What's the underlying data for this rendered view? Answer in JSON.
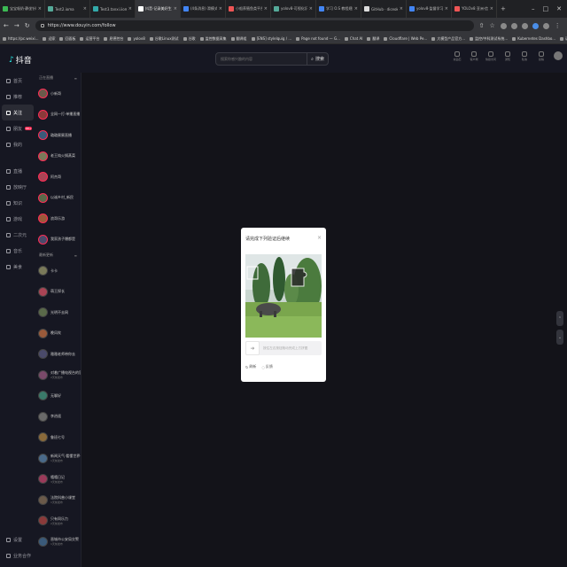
{
  "browser": {
    "tabs": [
      {
        "title": "宝宝吸奶·静坐针吹聊",
        "color": "#3cba54",
        "active": false
      },
      {
        "title": "Test2.ioma",
        "color": "#5a9",
        "active": false
      },
      {
        "title": "Test3.tanxi.iioma",
        "color": "#3aa",
        "active": false
      },
      {
        "title": "抖音-记录美好生活",
        "color": "#fff",
        "active": true
      },
      {
        "title": "(4条消息) 滑模式辅助定",
        "color": "#4285f4",
        "active": false
      },
      {
        "title": "小船养殖鱼类平台",
        "color": "#e55",
        "active": false
      },
      {
        "title": "yolov8-可视化识图工具",
        "color": "#5a9",
        "active": false
      },
      {
        "title": "学习 O.S 教程规则文",
        "color": "#4285f4",
        "active": false
      },
      {
        "title": "GitHub · diceoks/lehris",
        "color": "#ddd",
        "active": false
      },
      {
        "title": "yolov8·监督学习教程",
        "color": "#4285f4",
        "active": false
      },
      {
        "title": "YOLOv8 亚洲·信仰",
        "color": "#e55",
        "active": false
      }
    ],
    "new_tab_label": "+",
    "url": "https://www.douyin.com/follow",
    "bookmarks": [
      "https://pc.weixi...",
      "迎家",
      "回面板",
      "运营平台",
      "屈德控台",
      "yolov8",
      "谷歌Linux测试",
      "谷歌",
      "监控数据采集",
      "翻译组",
      "[ENS] stylelquig / ...",
      "Page not found — G...",
      "Chat AI",
      "翻译",
      "Cloudflare | Web Pe...",
      "大模型产品官方...",
      "监控/中科测试系统...",
      "Kubernetes Dashbo...",
      "语音服务平台",
      "语音文档",
      "微信",
      "语音控制",
      "所有书签"
    ]
  },
  "site": {
    "logo": "抖音",
    "search_placeholder": "搜索你感兴趣的内容",
    "search_button": "搜索",
    "top_icons": [
      "充钻石",
      "客户端",
      "快捷访问",
      "通知",
      "私信",
      "投稿",
      ""
    ]
  },
  "leftnav": {
    "items": [
      {
        "label": "首页",
        "active": false,
        "badge": ""
      },
      {
        "label": "推荐",
        "active": false,
        "badge": ""
      },
      {
        "label": "关注",
        "active": true,
        "badge": ""
      },
      {
        "label": "朋友",
        "active": false,
        "badge": "99+"
      },
      {
        "label": "我的",
        "active": false,
        "badge": ""
      }
    ],
    "items2": [
      "直播",
      "放映厅",
      "知识",
      "游戏",
      "二次元",
      "音乐",
      "美食"
    ],
    "bottom": [
      "设置",
      "业务合作"
    ]
  },
  "follow": {
    "header": "正在直播",
    "header2": "最新更新",
    "live": [
      "小新哥",
      "全网一打·单播直播",
      "璐璐蜜蜜直播",
      "老王炖火锅蒸菜",
      "阿杰哥",
      "以诚乡村_新民",
      "浪哥乐游",
      "我家孩子爆都是"
    ],
    "updates": [
      {
        "name": "卡卡",
        "sub": ""
      },
      {
        "name": "萌王探长",
        "sub": ""
      },
      {
        "name": "光明不去网",
        "sub": ""
      },
      {
        "name": "晚风吹",
        "sub": ""
      },
      {
        "name": "雅雅老师带你去",
        "sub": ""
      },
      {
        "name": "对着广播电视台的官方",
        "sub": "2天前发布"
      },
      {
        "name": "无聊好",
        "sub": ""
      },
      {
        "name": "李逍遥",
        "sub": ""
      },
      {
        "name": "鲁班七号",
        "sub": ""
      },
      {
        "name": "新闻天气·看懂世界一…",
        "sub": "1天前发布"
      },
      {
        "name": "嘻嘻日记",
        "sub": "3天前发布"
      },
      {
        "name": "法院科普小课堂",
        "sub": "1天前发布"
      },
      {
        "name": "只有同乐力",
        "sub": "2天前发布"
      },
      {
        "name": "晋城市公安局交警",
        "sub": "1天前发布"
      }
    ]
  },
  "captcha": {
    "title": "请完成下列验证后继续",
    "close": "×",
    "slider_hint": "按住左边按钮拖动完成上方拼图",
    "refresh_label": "刷新",
    "feedback_label": "反馈"
  }
}
